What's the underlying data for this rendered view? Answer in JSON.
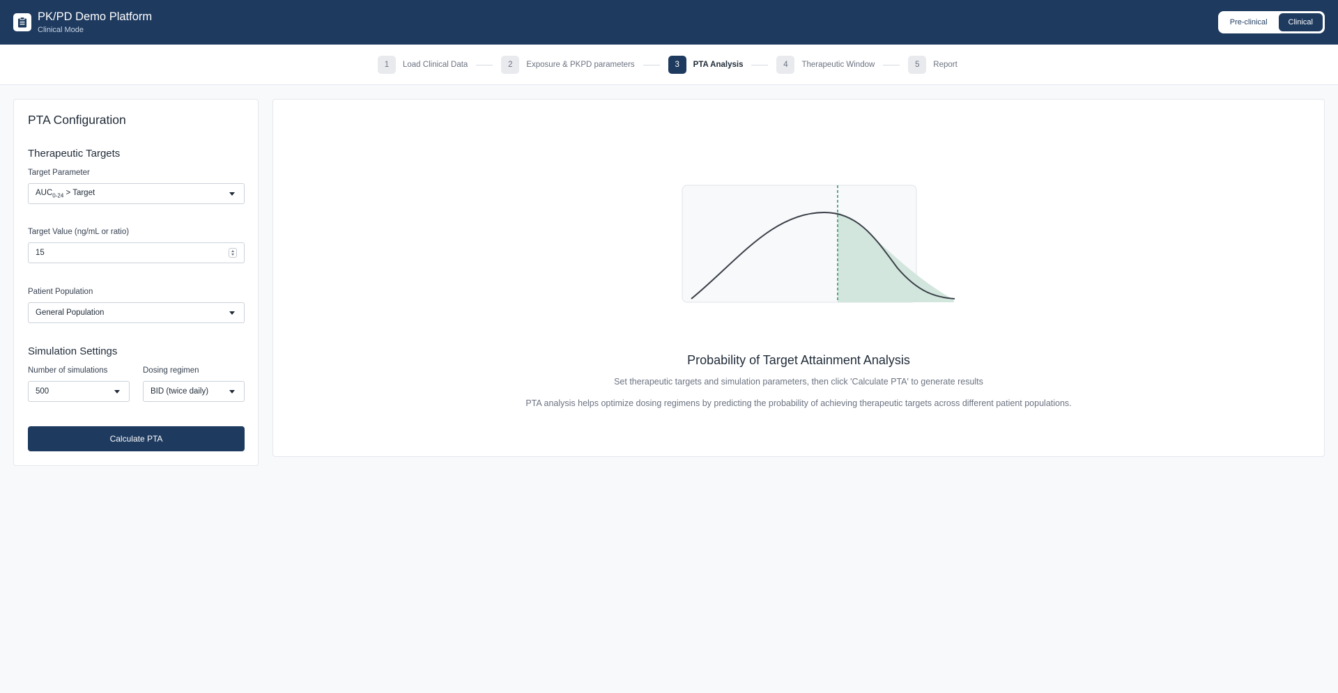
{
  "header": {
    "title": "PK/PD Demo Platform",
    "subtitle": "Clinical Mode",
    "modes": [
      {
        "label": "Pre-clinical",
        "active": false
      },
      {
        "label": "Clinical",
        "active": true
      }
    ]
  },
  "stepper": {
    "steps": [
      {
        "num": "1",
        "label": "Load Clinical Data",
        "active": false
      },
      {
        "num": "2",
        "label": "Exposure & PKPD parameters",
        "active": false
      },
      {
        "num": "3",
        "label": "PTA Analysis",
        "active": true
      },
      {
        "num": "4",
        "label": "Therapeutic Window",
        "active": false
      },
      {
        "num": "5",
        "label": "Report",
        "active": false
      }
    ]
  },
  "config": {
    "title": "PTA Configuration",
    "therapeutic_targets": {
      "heading": "Therapeutic Targets",
      "target_parameter_label": "Target Parameter",
      "target_parameter_main": "AUC",
      "target_parameter_sub": "0-24",
      "target_parameter_rest": " > Target",
      "target_value_label": "Target Value (ng/mL or ratio)",
      "target_value": "15",
      "population_label": "Patient Population",
      "population_value": "General Population"
    },
    "simulation": {
      "heading": "Simulation Settings",
      "num_sim_label": "Number of simulations",
      "num_sim_value": "500",
      "regimen_label": "Dosing regimen",
      "regimen_value": "BID (twice daily)"
    },
    "calculate_label": "Calculate PTA"
  },
  "main": {
    "title": "Probability of Target Attainment Analysis",
    "desc1": "Set therapeutic targets and simulation parameters, then click 'Calculate PTA' to generate results",
    "desc2": "PTA analysis helps optimize dosing regimens by predicting the probability of achieving therapeutic targets across different patient populations."
  },
  "colors": {
    "brand": "#1e3a5f",
    "shade": "#cde3d9",
    "dashed_line": "#2e8b6e"
  },
  "icons": {
    "logo": "clipboard-icon",
    "dropdown": "caret-down-icon",
    "spinner": "spinner-arrows-icon"
  }
}
